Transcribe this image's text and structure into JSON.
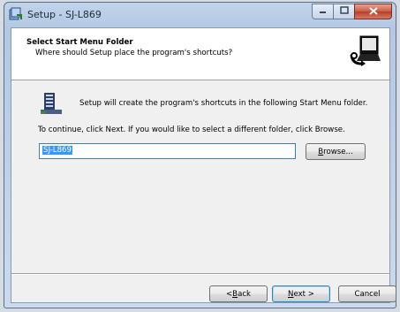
{
  "window": {
    "title": "Setup - SJ-L869"
  },
  "header": {
    "title": "Select Start Menu Folder",
    "subtitle": "Where should Setup place the program's shortcuts?"
  },
  "body": {
    "info_text": "Setup will create the program's shortcuts in the following Start Menu folder.",
    "instruction_text": "To continue, click Next. If you would like to select a different folder, click Browse."
  },
  "folder_input": {
    "value": "SJ-L869"
  },
  "buttons": {
    "browse_accel": "B",
    "browse_rest": "rowse...",
    "back_prefix": "< ",
    "back_accel": "B",
    "back_rest": "ack",
    "next_accel": "N",
    "next_rest": "ext >",
    "cancel": "Cancel"
  },
  "icons": {
    "app": "setup-icon",
    "wizard": "computer-install-icon",
    "folder": "start-menu-folder-icon",
    "minimize": "minimize-icon",
    "maximize": "maximize-icon",
    "close": "close-icon"
  }
}
